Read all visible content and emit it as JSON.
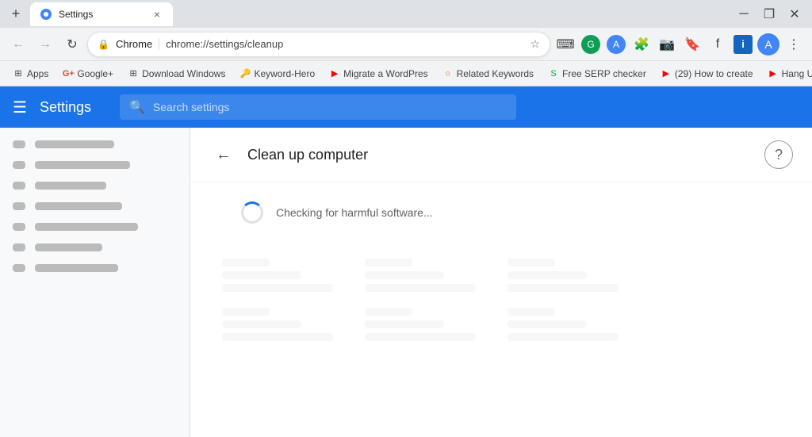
{
  "titleBar": {
    "newTabLabel": "+",
    "tab": {
      "title": "Settings",
      "closeLabel": "×"
    },
    "minimizeLabel": "─",
    "restoreLabel": "❐",
    "closeLabel": "✕"
  },
  "addressBar": {
    "backLabel": "←",
    "forwardLabel": "→",
    "reloadLabel": "↻",
    "siteName": "Chrome",
    "url": "chrome://settings/cleanup",
    "starLabel": "☆",
    "moreLabel": "⋮"
  },
  "bookmarks": [
    {
      "label": "Apps",
      "favicon": "⊞"
    },
    {
      "label": "Google+",
      "favicon": "G"
    },
    {
      "label": "Download Windows",
      "favicon": "⊞"
    },
    {
      "label": "Keyword-Hero",
      "favicon": "🔑"
    },
    {
      "label": "Migrate a WordPres",
      "favicon": "▶"
    },
    {
      "label": "Related Keywords",
      "favicon": "○"
    },
    {
      "label": "Free SERP checker",
      "favicon": "S"
    },
    {
      "label": "(29) How to create",
      "favicon": "▶"
    },
    {
      "label": "Hang Ups (Want Yo",
      "favicon": "▶"
    }
  ],
  "settings": {
    "menuIconLabel": "☰",
    "title": "Settings",
    "searchPlaceholder": "Search settings"
  },
  "cleanup": {
    "backLabel": "←",
    "title": "Clean up computer",
    "helpLabel": "?",
    "checkingText": "Checking for harmful software..."
  }
}
